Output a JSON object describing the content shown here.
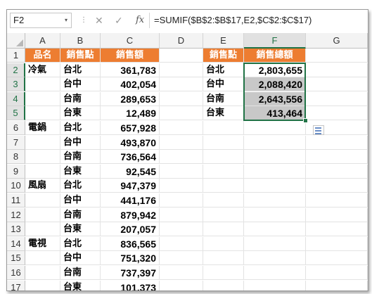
{
  "formula_bar": {
    "name_box": "F2",
    "dropdown_glyph": "▾",
    "separator_glyph": "⋮",
    "cancel_glyph": "✕",
    "enter_glyph": "✓",
    "fx_label": "fx",
    "formula": "=SUMIF($B$2:$B$17,E2,$C$2:$C$17)"
  },
  "columns": [
    "A",
    "B",
    "C",
    "D",
    "E",
    "F",
    "G"
  ],
  "rows": [
    "1",
    "2",
    "3",
    "4",
    "5",
    "6",
    "7",
    "8",
    "9",
    "10",
    "11",
    "12",
    "13",
    "14",
    "15",
    "16",
    "17"
  ],
  "table": {
    "headers": [
      "品名",
      "銷售點",
      "銷售額"
    ],
    "rows": [
      [
        "冷氣",
        "台北",
        "361,783"
      ],
      [
        "",
        "台中",
        "402,054"
      ],
      [
        "",
        "台南",
        "289,653"
      ],
      [
        "",
        "台東",
        "12,489"
      ],
      [
        "電鍋",
        "台北",
        "657,928"
      ],
      [
        "",
        "台中",
        "493,870"
      ],
      [
        "",
        "台南",
        "736,564"
      ],
      [
        "",
        "台東",
        "92,545"
      ],
      [
        "風扇",
        "台北",
        "947,379"
      ],
      [
        "",
        "台中",
        "441,176"
      ],
      [
        "",
        "台南",
        "879,942"
      ],
      [
        "",
        "台東",
        "207,057"
      ],
      [
        "電視",
        "台北",
        "836,565"
      ],
      [
        "",
        "台中",
        "751,320"
      ],
      [
        "",
        "台南",
        "737,397"
      ],
      [
        "",
        "台東",
        "101,373"
      ]
    ]
  },
  "summary": {
    "headers": [
      "銷售點",
      "銷售總額"
    ],
    "rows": [
      [
        "台北",
        "2,803,655"
      ],
      [
        "台中",
        "2,088,420"
      ],
      [
        "台南",
        "2,643,556"
      ],
      [
        "台東",
        "413,464"
      ]
    ]
  },
  "colors": {
    "header_bg": "#ed7d31",
    "selection_green": "#217346",
    "selected_fill": "#c8c8c8"
  },
  "icons": {
    "quick_analysis": "quick-analysis-icon"
  }
}
